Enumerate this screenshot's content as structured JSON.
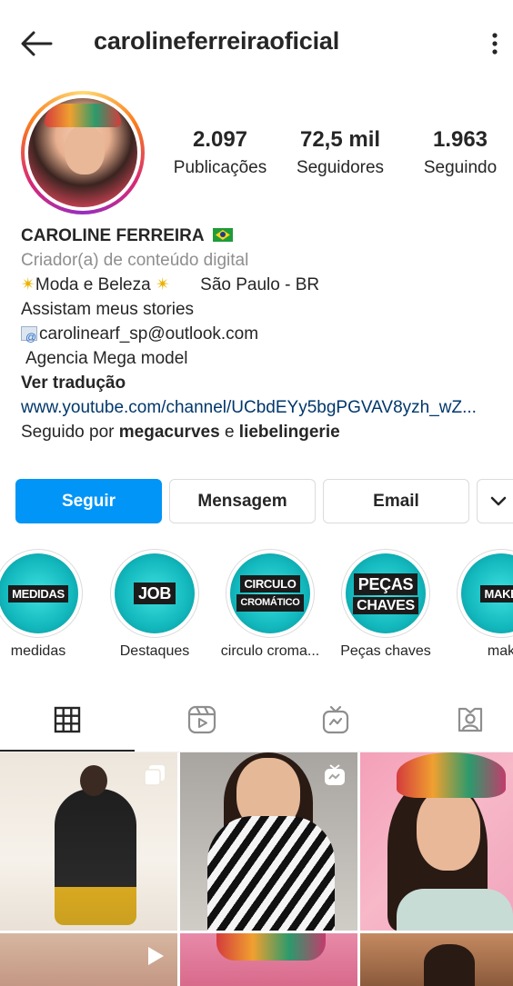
{
  "header": {
    "username": "carolineferreiraoficial"
  },
  "stats": {
    "posts": {
      "value": "2.097",
      "label": "Publicações"
    },
    "followers": {
      "value": "72,5 mil",
      "label": "Seguidores"
    },
    "following": {
      "value": "1.963",
      "label": "Seguindo"
    }
  },
  "bio": {
    "name": "CAROLINE FERREIRA",
    "category": "Criador(a) de conteúdo digital",
    "line1_main": "Moda e Beleza",
    "line1_location": "São Paulo - BR",
    "line2": "Assistam meus stories",
    "email": "carolinearf_sp@outlook.com",
    "agency": "Agencia Mega model",
    "translate": "Ver tradução",
    "link": "www.youtube.com/channel/UCbdEYy5bgPGVAV8yzh_wZ...",
    "followed_prefix": "Seguido por",
    "followed_user1": "megacurves",
    "followed_and": "e",
    "followed_user2": "liebelingerie"
  },
  "actions": {
    "follow": "Seguir",
    "message": "Mensagem",
    "email": "Email"
  },
  "highlights": [
    {
      "cover_text": "MEDIDAS",
      "caption": "medidas"
    },
    {
      "cover_text": "JOB",
      "caption": "Destaques"
    },
    {
      "cover_text_1": "CIRCULO",
      "cover_text_2": "CROMÁTICO",
      "caption": "circulo croma..."
    },
    {
      "cover_text_1": "PEÇAS",
      "cover_text_2": "CHAVES",
      "caption": "Peças chaves"
    },
    {
      "cover_text": "MAKE",
      "caption": "mak"
    }
  ],
  "colors": {
    "accent": "#0095f6",
    "link": "#00376b",
    "secondary_text": "#8e8e8e",
    "highlight_cover": "#12b8bd"
  },
  "icons": {
    "back": "arrow-left-icon",
    "more": "more-vertical-icon",
    "dropdown": "chevron-down-icon",
    "tab_grid": "grid-icon",
    "tab_reels": "reels-icon",
    "tab_igtv": "igtv-icon",
    "tab_tagged": "tagged-icon"
  }
}
